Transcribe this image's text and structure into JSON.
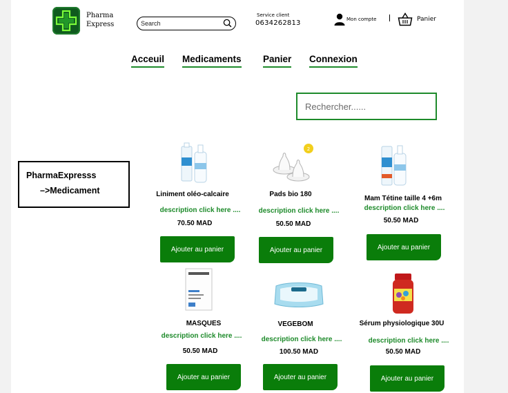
{
  "header": {
    "brand_line1": "Pharma",
    "brand_line2": "Express",
    "search_placeholder": "Search",
    "service_label": "Service client",
    "service_phone": "0634262813",
    "account_label": "Mon compte",
    "cart_label": "Panier"
  },
  "nav": {
    "items": [
      "Acceuil",
      "Medicaments",
      "Panier",
      "Connexion"
    ]
  },
  "filter": {
    "placeholder": "Rechercher......"
  },
  "breadcrumb": {
    "line1": "PharmaExpresss",
    "line2": "–>Medicament"
  },
  "products": [
    {
      "name": "Liniment oléo-calcaire",
      "description": "description click here ....",
      "price": "70.50 MAD",
      "button": "Ajouter au panier",
      "image": "nasal-spray-bottle"
    },
    {
      "name": "Pads bio 180",
      "description": "description click here ....",
      "price": "50.50 MAD",
      "button": "Ajouter au panier",
      "image": "baby-bottle-nipples"
    },
    {
      "name": "Mam Tétine taille 4 +6m",
      "description": "description click here ....",
      "price": "50.50 MAD",
      "button": "Ajouter au panier",
      "image": "nasal-spray-bottle"
    },
    {
      "name": "MASQUES",
      "description": "description click here ....",
      "price": "50.50 MAD",
      "button": "Ajouter au panier",
      "image": "cream-box"
    },
    {
      "name": "VEGEBOM",
      "description": "description click here ....",
      "price": "100.50 MAD",
      "button": "Ajouter au panier",
      "image": "wipes-pack"
    },
    {
      "name": "Sérum physiologique 30U",
      "description": "description click here ....",
      "price": "50.50 MAD",
      "button": "Ajouter au panier",
      "image": "gummies-jar"
    }
  ],
  "colors": {
    "accent_green": "#1d8a2a",
    "button_green": "#0a7d0a",
    "logo_green": "#0f5a1e"
  }
}
